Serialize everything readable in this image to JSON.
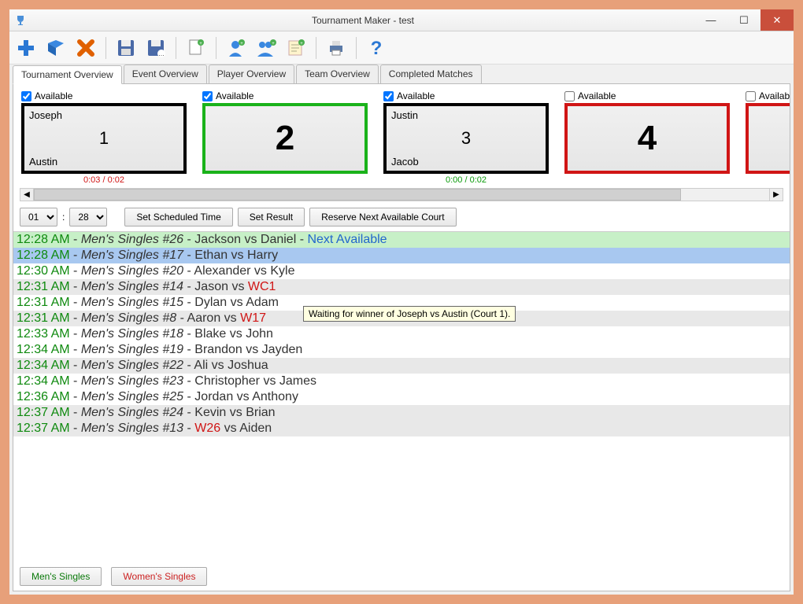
{
  "window": {
    "title": "Tournament Maker - test",
    "min": "—",
    "max": "☐",
    "close": "✕"
  },
  "toolbar": {
    "items": [
      {
        "name": "new-icon",
        "tip": "New"
      },
      {
        "name": "open-icon",
        "tip": "Open"
      },
      {
        "name": "delete-icon",
        "tip": "Delete"
      },
      {
        "name": "save-icon",
        "tip": "Save"
      },
      {
        "name": "save-as-icon",
        "tip": "Save As"
      },
      {
        "name": "new-doc-icon",
        "tip": "New Doc"
      },
      {
        "name": "add-player-icon",
        "tip": "Add Player"
      },
      {
        "name": "add-team-icon",
        "tip": "Add Team"
      },
      {
        "name": "notes-icon",
        "tip": "Notes"
      },
      {
        "name": "print-icon",
        "tip": "Print"
      },
      {
        "name": "help-icon",
        "tip": "Help"
      }
    ]
  },
  "tabs": [
    {
      "label": "Tournament Overview",
      "active": true
    },
    {
      "label": "Event Overview",
      "active": false
    },
    {
      "label": "Player Overview",
      "active": false
    },
    {
      "label": "Team Overview",
      "active": false
    },
    {
      "label": "Completed Matches",
      "active": false
    }
  ],
  "courts": [
    {
      "available": true,
      "border": "black",
      "big": false,
      "num": "1",
      "topPlayer": "Joseph",
      "bottomPlayer": "Austin",
      "timer": "0:03 / 0:02",
      "timerColor": "red"
    },
    {
      "available": true,
      "border": "green",
      "big": true,
      "num": "2",
      "topPlayer": "",
      "bottomPlayer": "",
      "timer": "",
      "timerColor": ""
    },
    {
      "available": true,
      "border": "black",
      "big": false,
      "num": "3",
      "topPlayer": "Justin",
      "bottomPlayer": "Jacob",
      "timer": "0:00 / 0:02",
      "timerColor": "green"
    },
    {
      "available": false,
      "border": "red",
      "big": true,
      "num": "4",
      "topPlayer": "",
      "bottomPlayer": "",
      "timer": "",
      "timerColor": ""
    },
    {
      "available": false,
      "border": "red",
      "big": true,
      "num": "",
      "topPlayer": "",
      "bottomPlayer": "",
      "timer": "",
      "timerColor": ""
    }
  ],
  "availableLabel": "Available",
  "timeSelect": {
    "hour": "01",
    "colon": ":",
    "minute": "28"
  },
  "buttons": {
    "setScheduled": "Set Scheduled Time",
    "setResult": "Set Result",
    "reserve": "Reserve Next Available Court"
  },
  "matches": [
    {
      "bg": "row-green",
      "time": "12:28 AM",
      "event": "Men's Singles #26",
      "players": "Jackson vs Daniel",
      "suffix": " - ",
      "next": "Next Available",
      "wcode": ""
    },
    {
      "bg": "row-blue",
      "time": "12:28 AM",
      "event": "Men's Singles #17",
      "players": "Ethan vs Harry",
      "suffix": "",
      "next": "",
      "wcode": ""
    },
    {
      "bg": "row-white",
      "time": "12:30 AM",
      "event": "Men's Singles #20",
      "players": "Alexander vs Kyle",
      "suffix": "",
      "next": "",
      "wcode": ""
    },
    {
      "bg": "row-grey",
      "time": "12:31 AM",
      "event": "Men's Singles #14",
      "players": "Jason vs ",
      "suffix": "",
      "next": "",
      "wcode": "WC1"
    },
    {
      "bg": "row-white",
      "time": "12:31 AM",
      "event": "Men's Singles #15",
      "players": "Dylan vs Adam",
      "suffix": "",
      "next": "",
      "wcode": ""
    },
    {
      "bg": "row-grey",
      "time": "12:31 AM",
      "event": "Men's Singles #8",
      "players": "Aaron vs ",
      "suffix": "",
      "next": "",
      "wcode": "W17"
    },
    {
      "bg": "row-white",
      "time": "12:33 AM",
      "event": "Men's Singles #18",
      "players": "Blake vs John",
      "suffix": "",
      "next": "",
      "wcode": ""
    },
    {
      "bg": "row-white",
      "time": "12:34 AM",
      "event": "Men's Singles #19",
      "players": "Brandon vs Jayden",
      "suffix": "",
      "next": "",
      "wcode": ""
    },
    {
      "bg": "row-grey",
      "time": "12:34 AM",
      "event": "Men's Singles #22",
      "players": "Ali vs Joshua",
      "suffix": "",
      "next": "",
      "wcode": ""
    },
    {
      "bg": "row-white",
      "time": "12:34 AM",
      "event": "Men's Singles #23",
      "players": "Christopher vs James",
      "suffix": "",
      "next": "",
      "wcode": ""
    },
    {
      "bg": "row-white",
      "time": "12:36 AM",
      "event": "Men's Singles #25",
      "players": "Jordan vs Anthony",
      "suffix": "",
      "next": "",
      "wcode": ""
    },
    {
      "bg": "row-grey",
      "time": "12:37 AM",
      "event": "Men's Singles #24",
      "players": "Kevin vs Brian",
      "suffix": "",
      "next": "",
      "wcode": ""
    },
    {
      "bg": "row-grey",
      "time": "12:37 AM",
      "event": "Men's Singles #13",
      "players": " vs Aiden",
      "suffix": "",
      "next": "",
      "wcode": "W26",
      "wcodeBefore": true
    }
  ],
  "tooltip": "Waiting for winner of Joseph vs Austin (Court 1).",
  "footer": {
    "men": "Men's Singles",
    "women": "Women's Singles"
  }
}
